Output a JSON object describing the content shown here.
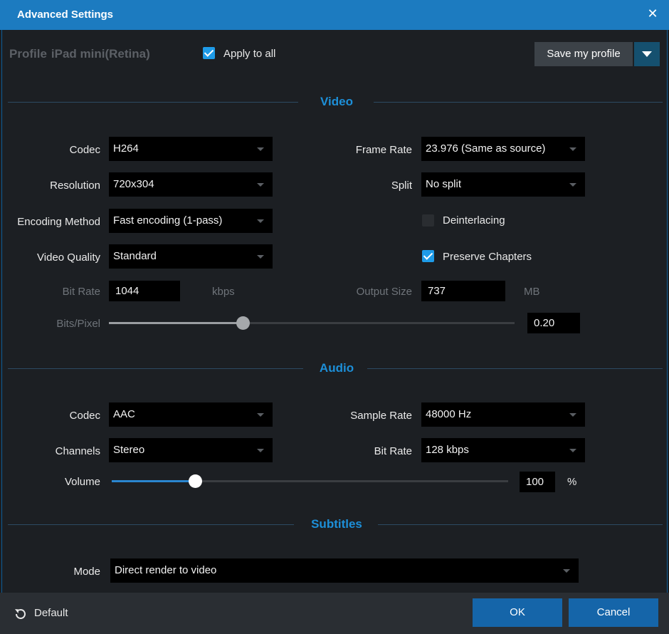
{
  "window": {
    "title": "Advanced Settings",
    "close_icon": "close-icon"
  },
  "profile": {
    "label": "Profile",
    "name": "iPad mini(Retina)",
    "apply_all_label": "Apply to all",
    "apply_all_checked": true,
    "save_label": "Save my profile"
  },
  "video": {
    "heading": "Video",
    "codec_label": "Codec",
    "codec_value": "H264",
    "framerate_label": "Frame Rate",
    "framerate_value": "23.976 (Same as source)",
    "resolution_label": "Resolution",
    "resolution_value": "720x304",
    "split_label": "Split",
    "split_value": "No split",
    "encoding_label": "Encoding Method",
    "encoding_value": "Fast encoding (1-pass)",
    "deinterlacing_label": "Deinterlacing",
    "deinterlacing_checked": false,
    "quality_label": "Video Quality",
    "quality_value": "Standard",
    "chapters_label": "Preserve Chapters",
    "chapters_checked": true,
    "bitrate_label": "Bit Rate",
    "bitrate_value": "1044",
    "bitrate_unit": "kbps",
    "outputsize_label": "Output Size",
    "outputsize_value": "737",
    "outputsize_unit": "MB",
    "bitspixel_label": "Bits/Pixel",
    "bitspixel_value": "0.20",
    "bitspixel_fraction": 0.33
  },
  "audio": {
    "heading": "Audio",
    "codec_label": "Codec",
    "codec_value": "AAC",
    "samplerate_label": "Sample Rate",
    "samplerate_value": "48000 Hz",
    "channels_label": "Channels",
    "channels_value": "Stereo",
    "bitrate_label": "Bit Rate",
    "bitrate_value": "128 kbps",
    "volume_label": "Volume",
    "volume_value": "100",
    "volume_unit": "%",
    "volume_fraction": 0.21
  },
  "subtitles": {
    "heading": "Subtitles",
    "mode_label": "Mode",
    "mode_value": "Direct render to video"
  },
  "footer": {
    "default_label": "Default",
    "ok_label": "OK",
    "cancel_label": "Cancel"
  },
  "colors": {
    "accent": "#1d8fd8",
    "titlebar": "#1c7bc0",
    "button": "#1565a9"
  }
}
